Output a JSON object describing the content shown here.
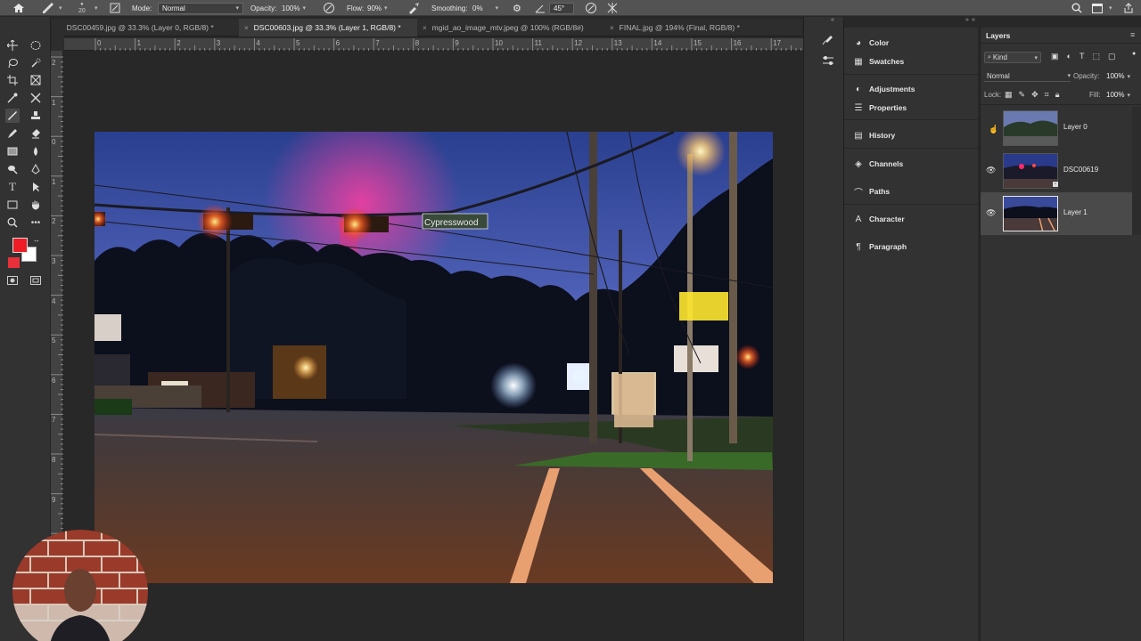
{
  "options_bar": {
    "mode_label": "Mode:",
    "mode_value": "Normal",
    "opacity_label": "Opacity:",
    "opacity_value": "100%",
    "flow_label": "Flow:",
    "flow_value": "90%",
    "smoothing_label": "Smoothing:",
    "smoothing_value": "0%",
    "angle_value": "45°",
    "brush_size": "20"
  },
  "tabs": [
    {
      "label": "DSC00459.jpg @ 33.3% (Layer 0, RGB/8) *",
      "active": false
    },
    {
      "label": "DSC00603.jpg @ 33.3% (Layer 1, RGB/8) *",
      "active": true
    },
    {
      "label": "mgid_ao_image_mtv.jpeg @ 100% (RGB/8#)",
      "active": false
    },
    {
      "label": "FINAL.jpg @ 194% (Final, RGB/8) *",
      "active": false
    }
  ],
  "ruler": {
    "h": [
      "0",
      "1",
      "2",
      "3",
      "4",
      "5",
      "6",
      "7",
      "8",
      "9",
      "10",
      "11",
      "12",
      "13",
      "14",
      "15",
      "16",
      "17"
    ],
    "v": [
      "2",
      "1",
      "0",
      "1",
      "2",
      "3",
      "4",
      "5",
      "6",
      "7",
      "8",
      "9"
    ]
  },
  "canvas": {
    "street_sign": "Cypresswood"
  },
  "panels": {
    "items": [
      "Color",
      "Swatches",
      "Adjustments",
      "Properties",
      "History",
      "Channels",
      "Paths",
      "Character",
      "Paragraph"
    ]
  },
  "layers_panel": {
    "title": "Layers",
    "kind_label": "Kind",
    "blend_mode": "Normal",
    "opacity_label": "Opacity:",
    "opacity_value": "100%",
    "lock_label": "Lock:",
    "fill_label": "Fill:",
    "fill_value": "100%",
    "layers": [
      {
        "name": "Layer 0",
        "visible": false,
        "selected": false
      },
      {
        "name": "DSC00619",
        "visible": true,
        "selected": false
      },
      {
        "name": "Layer 1",
        "visible": true,
        "selected": true
      }
    ]
  },
  "colors": {
    "foreground": "#ee1c24",
    "background": "#ffffff",
    "swatch_extra": "#e8303a"
  },
  "icons": [
    "home-icon",
    "brush-icon",
    "airbrush-icon",
    "smoothing-gear-icon",
    "angle-icon",
    "pressure-icon",
    "search-icon",
    "workspace-icon",
    "share-icon"
  ]
}
